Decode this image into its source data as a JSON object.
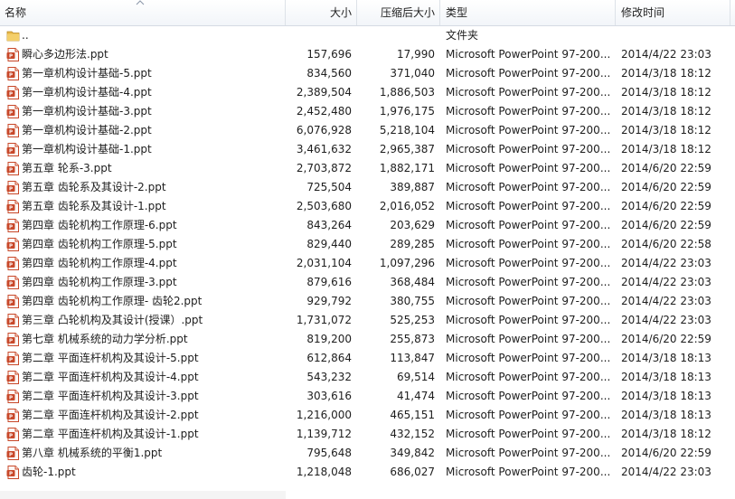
{
  "columns": {
    "name": "名称",
    "size": "大小",
    "compressed": "压缩后大小",
    "type": "类型",
    "modified": "修改时间"
  },
  "colors": {
    "ppt_icon": "#c8482a",
    "folder_icon": "#e8b84a",
    "header_border": "#d5dbe3"
  },
  "files": [
    {
      "icon": "folder-up-icon",
      "name": "..",
      "size": "",
      "compressed": "",
      "type": "文件夹",
      "modified": ""
    },
    {
      "icon": "ppt-file-icon",
      "name": "瞬心多边形法.ppt",
      "size": "157,696",
      "compressed": "17,990",
      "type": "Microsoft PowerPoint 97-200...",
      "modified": "2014/4/22 23:03"
    },
    {
      "icon": "ppt-file-icon",
      "name": "第一章机构设计基础-5.ppt",
      "size": "834,560",
      "compressed": "371,040",
      "type": "Microsoft PowerPoint 97-200...",
      "modified": "2014/3/18 18:12"
    },
    {
      "icon": "ppt-file-icon",
      "name": "第一章机构设计基础-4.ppt",
      "size": "2,389,504",
      "compressed": "1,886,503",
      "type": "Microsoft PowerPoint 97-200...",
      "modified": "2014/3/18 18:12"
    },
    {
      "icon": "ppt-file-icon",
      "name": "第一章机构设计基础-3.ppt",
      "size": "2,452,480",
      "compressed": "1,976,175",
      "type": "Microsoft PowerPoint 97-200...",
      "modified": "2014/3/18 18:12"
    },
    {
      "icon": "ppt-file-icon",
      "name": "第一章机构设计基础-2.ppt",
      "size": "6,076,928",
      "compressed": "5,218,104",
      "type": "Microsoft PowerPoint 97-200...",
      "modified": "2014/3/18 18:12"
    },
    {
      "icon": "ppt-file-icon",
      "name": "第一章机构设计基础-1.ppt",
      "size": "3,461,632",
      "compressed": "2,965,387",
      "type": "Microsoft PowerPoint 97-200...",
      "modified": "2014/3/18 18:12"
    },
    {
      "icon": "ppt-file-icon",
      "name": "第五章 轮系-3.ppt",
      "size": "2,703,872",
      "compressed": "1,882,171",
      "type": "Microsoft PowerPoint 97-200...",
      "modified": "2014/6/20 22:59"
    },
    {
      "icon": "ppt-file-icon",
      "name": "第五章 齿轮系及其设计-2.ppt",
      "size": "725,504",
      "compressed": "389,887",
      "type": "Microsoft PowerPoint 97-200...",
      "modified": "2014/6/20 22:59"
    },
    {
      "icon": "ppt-file-icon",
      "name": "第五章 齿轮系及其设计-1.ppt",
      "size": "2,503,680",
      "compressed": "2,016,052",
      "type": "Microsoft PowerPoint 97-200...",
      "modified": "2014/6/20 22:59"
    },
    {
      "icon": "ppt-file-icon",
      "name": "第四章 齿轮机构工作原理-6.ppt",
      "size": "843,264",
      "compressed": "203,629",
      "type": "Microsoft PowerPoint 97-200...",
      "modified": "2014/6/20 22:59"
    },
    {
      "icon": "ppt-file-icon",
      "name": "第四章 齿轮机构工作原理-5.ppt",
      "size": "829,440",
      "compressed": "289,285",
      "type": "Microsoft PowerPoint 97-200...",
      "modified": "2014/6/20 22:58"
    },
    {
      "icon": "ppt-file-icon",
      "name": "第四章 齿轮机构工作原理-4.ppt",
      "size": "2,031,104",
      "compressed": "1,097,296",
      "type": "Microsoft PowerPoint 97-200...",
      "modified": "2014/4/22 23:03"
    },
    {
      "icon": "ppt-file-icon",
      "name": "第四章 齿轮机构工作原理-3.ppt",
      "size": "879,616",
      "compressed": "368,484",
      "type": "Microsoft PowerPoint 97-200...",
      "modified": "2014/4/22 23:03"
    },
    {
      "icon": "ppt-file-icon",
      "name": "第四章 齿轮机构工作原理- 齿轮2.ppt",
      "size": "929,792",
      "compressed": "380,755",
      "type": "Microsoft PowerPoint 97-200...",
      "modified": "2014/4/22 23:03"
    },
    {
      "icon": "ppt-file-icon",
      "name": "第三章 凸轮机构及其设计(授课）.ppt",
      "size": "1,731,072",
      "compressed": "525,253",
      "type": "Microsoft PowerPoint 97-200...",
      "modified": "2014/4/22 23:03"
    },
    {
      "icon": "ppt-file-icon",
      "name": "第七章 机械系统的动力学分析.ppt",
      "size": "819,200",
      "compressed": "255,873",
      "type": "Microsoft PowerPoint 97-200...",
      "modified": "2014/6/20 22:59"
    },
    {
      "icon": "ppt-file-icon",
      "name": "第二章 平面连杆机构及其设计-5.ppt",
      "size": "612,864",
      "compressed": "113,847",
      "type": "Microsoft PowerPoint 97-200...",
      "modified": "2014/3/18 18:13"
    },
    {
      "icon": "ppt-file-icon",
      "name": "第二章 平面连杆机构及其设计-4.ppt",
      "size": "543,232",
      "compressed": "69,514",
      "type": "Microsoft PowerPoint 97-200...",
      "modified": "2014/3/18 18:13"
    },
    {
      "icon": "ppt-file-icon",
      "name": "第二章 平面连杆机构及其设计-3.ppt",
      "size": "303,616",
      "compressed": "41,474",
      "type": "Microsoft PowerPoint 97-200...",
      "modified": "2014/3/18 18:13"
    },
    {
      "icon": "ppt-file-icon",
      "name": "第二章 平面连杆机构及其设计-2.ppt",
      "size": "1,216,000",
      "compressed": "465,151",
      "type": "Microsoft PowerPoint 97-200...",
      "modified": "2014/3/18 18:13"
    },
    {
      "icon": "ppt-file-icon",
      "name": "第二章 平面连杆机构及其设计-1.ppt",
      "size": "1,139,712",
      "compressed": "432,152",
      "type": "Microsoft PowerPoint 97-200...",
      "modified": "2014/3/18 18:12"
    },
    {
      "icon": "ppt-file-icon",
      "name": "第八章 机械系统的平衡1.ppt",
      "size": "795,648",
      "compressed": "349,842",
      "type": "Microsoft PowerPoint 97-200...",
      "modified": "2014/6/20 22:59"
    },
    {
      "icon": "ppt-file-icon",
      "name": "齿轮-1.ppt",
      "size": "1,218,048",
      "compressed": "686,027",
      "type": "Microsoft PowerPoint 97-200...",
      "modified": "2014/4/22 23:03"
    }
  ]
}
